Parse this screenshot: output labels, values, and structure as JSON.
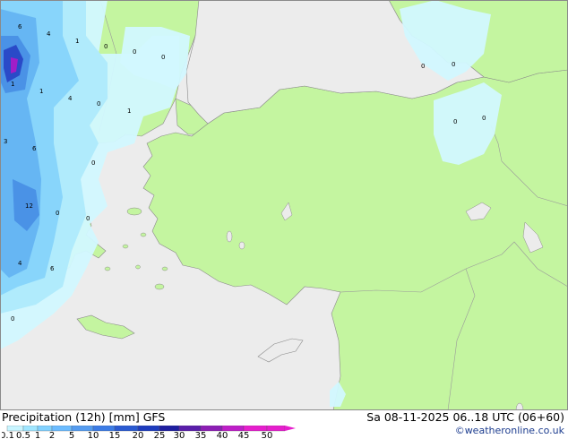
{
  "footer": {
    "title": "Precipitation (12h) [mm] GFS",
    "datetime": "Sa 08-11-2025 06..18 UTC (06+60)",
    "credit": "©weatheronline.co.uk"
  },
  "legend": {
    "values": [
      "0.1",
      "0.5",
      "1",
      "2",
      "5",
      "10",
      "15",
      "20",
      "25",
      "30",
      "35",
      "40",
      "45",
      "50"
    ],
    "colors": [
      "#c8f5ff",
      "#a0e6ff",
      "#82d2ff",
      "#6cbcff",
      "#559cf0",
      "#3c7ce6",
      "#2a5ad2",
      "#1e3cbe",
      "#1e1ea0",
      "#5a1eaa",
      "#8c1eb4",
      "#be1ec8",
      "#e61ecd",
      "#e61ecd"
    ]
  },
  "map": {
    "colors": {
      "sea": "#ececec",
      "land": "#c4f5a0",
      "coast": "#8a8a8a",
      "precip_light": "#d2f8ff",
      "precip_low": "#aeeafc",
      "precip_mid": "#86d4fb",
      "precip_high": "#64b4f2",
      "precip_heavy": "#4a92e6",
      "precip_peak": "#2a4ac8",
      "precip_max": "#a01ec8"
    },
    "labels": [
      "6",
      "4",
      "1",
      "0",
      "0",
      "0",
      "1",
      "1",
      "4",
      "0",
      "1",
      "3",
      "6",
      "0",
      "12",
      "0",
      "0",
      "4",
      "6",
      "0",
      "0",
      "0",
      "0",
      "0"
    ]
  }
}
